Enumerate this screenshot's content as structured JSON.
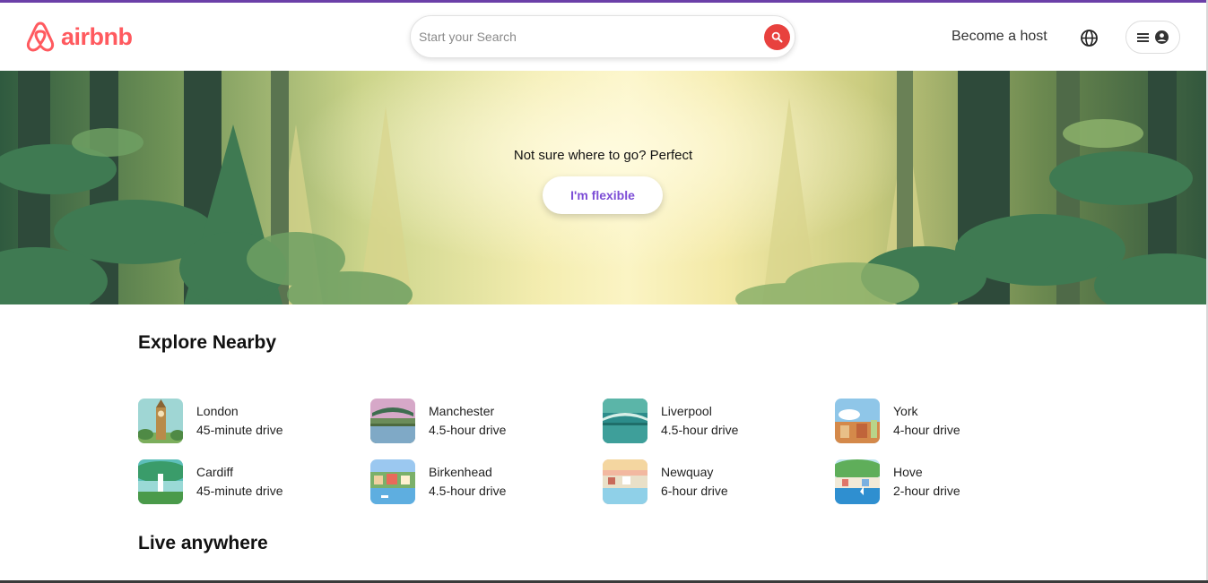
{
  "brand": {
    "name": "airbnb",
    "color": "#ff5a5f"
  },
  "header": {
    "search_placeholder": "Start your Search",
    "host_label": "Become a host",
    "accent": "#e8413e"
  },
  "hero": {
    "tagline": "Not sure where to go? Perfect",
    "button_label": "I'm flexible",
    "button_color": "#7c4dd6"
  },
  "explore": {
    "title": "Explore Nearby",
    "items": [
      {
        "city": "London",
        "distance": "45-minute drive"
      },
      {
        "city": "Manchester",
        "distance": "4.5-hour drive"
      },
      {
        "city": "Liverpool",
        "distance": "4.5-hour drive"
      },
      {
        "city": "York",
        "distance": "4-hour drive"
      },
      {
        "city": "Cardiff",
        "distance": "45-minute drive"
      },
      {
        "city": "Birkenhead",
        "distance": "4.5-hour drive"
      },
      {
        "city": "Newquay",
        "distance": "6-hour drive"
      },
      {
        "city": "Hove",
        "distance": "2-hour drive"
      }
    ]
  },
  "live": {
    "title": "Live anywhere"
  }
}
